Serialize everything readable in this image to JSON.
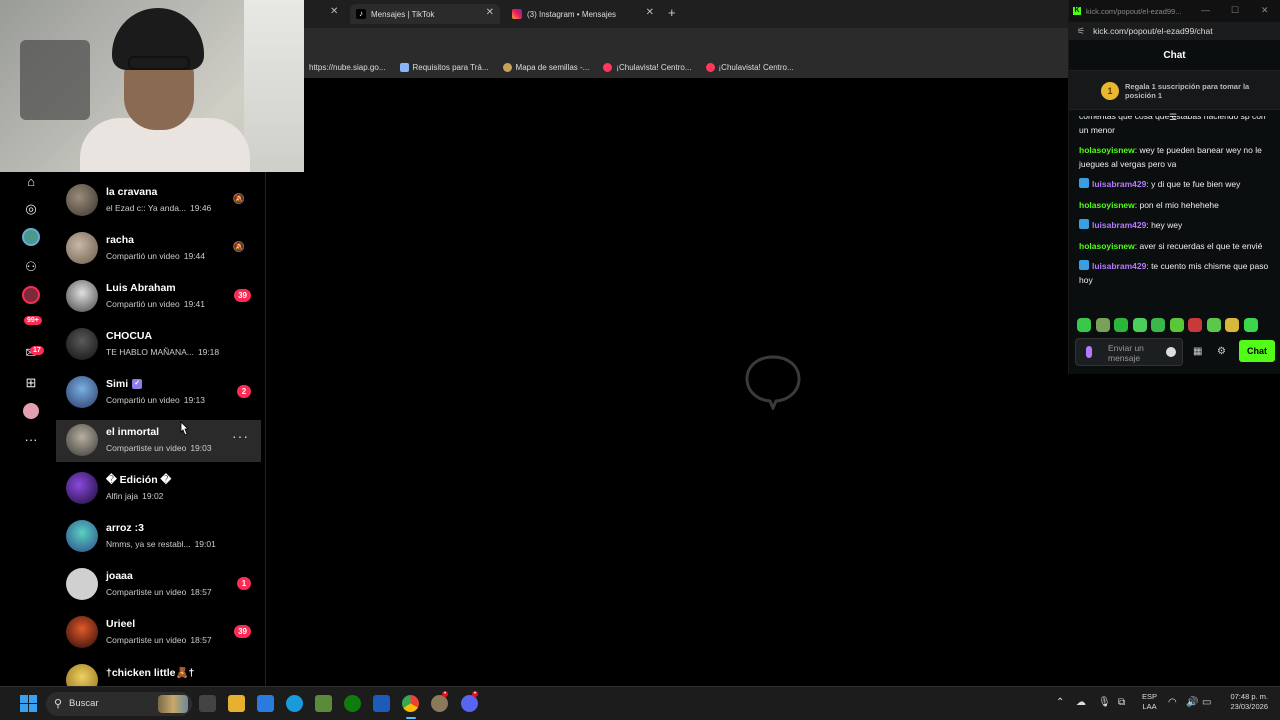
{
  "browser": {
    "tabs": [
      {
        "label": "Mensajes | TikTok",
        "icon": "tiktok-icon",
        "active": true
      },
      {
        "label": "(3) Instagram • Mensajes",
        "icon": "instagram-icon",
        "active": false
      }
    ],
    "bookmarks": [
      {
        "label": "https://nube.siap.go..."
      },
      {
        "label": "Requisitos para Trá..."
      },
      {
        "label": "Mapa de semillas -..."
      },
      {
        "label": "¡Chulavista! Centro..."
      },
      {
        "label": "¡Chulavista! Centro..."
      }
    ]
  },
  "left_nav": {
    "badges": {
      "activity": "99+",
      "inbox": "17"
    }
  },
  "conversations": [
    {
      "name": "la cravana",
      "preview": "el Ezad c:: Ya anda...",
      "time": "19:46",
      "muted": true
    },
    {
      "name": "racha",
      "preview": "Compartió un video",
      "time": "19:44",
      "muted": true
    },
    {
      "name": "Luis Abraham",
      "preview": "Compartió un video",
      "time": "19:41",
      "badge": "39"
    },
    {
      "name": "CHOCUA",
      "preview": "TE HABLO MAÑANA...",
      "time": "19:18"
    },
    {
      "name": "Simi",
      "preview": "Compartió un video",
      "time": "19:13",
      "badge": "2",
      "verified": true
    },
    {
      "name": "el inmortal",
      "preview": "Compartiste un video",
      "time": "19:03",
      "hover": true
    },
    {
      "name": "� Edición �",
      "preview": "Alfin jaja",
      "time": "19:02"
    },
    {
      "name": "arroz :3",
      "preview": "Nmms, ya se restabl...",
      "time": "19:01"
    },
    {
      "name": "joaaa",
      "preview": "Compartiste un video",
      "time": "18:57",
      "badge": "1"
    },
    {
      "name": "Urieel",
      "preview": "Compartiste un video",
      "time": "18:57",
      "badge": "39"
    },
    {
      "name": "†chicken little🧸†",
      "preview": "",
      "time": ""
    }
  ],
  "kick": {
    "window_url_short": "kick.com/popout/el-ezad99...",
    "url": "kick.com/popout/el-ezad99/chat",
    "header": "Chat",
    "gift_text": "Regala 1 suscripción para tomar la posición 1",
    "gift_rank": "1",
    "messages": [
      {
        "user": "",
        "text": "comentas que cosa que estabas haciendo sp con un menor",
        "color": ""
      },
      {
        "user": "holasoyisnew",
        "text": ": wey te pueden banear wey no le juegues al vergas pero va",
        "color": "green"
      },
      {
        "user": "luisabram429",
        "text": ": y di que te fue bien wey",
        "color": "purple",
        "sub": true
      },
      {
        "user": "holasoyisnew",
        "text": ": pon el mio hehehehe",
        "color": "green"
      },
      {
        "user": "luisabram429",
        "text": ": hey wey",
        "color": "purple",
        "sub": true
      },
      {
        "user": "holasoyisnew",
        "text": ": aver si recuerdas el que te envié",
        "color": "green"
      },
      {
        "user": "luisabram429",
        "text": ": te cuento mis chisme que paso hoy",
        "color": "purple",
        "sub": true
      }
    ],
    "input_placeholder": "Enviar un mensaje",
    "send_label": "Chat"
  },
  "taskbar": {
    "search_label": "Buscar",
    "lang_top": "ESP",
    "lang_bottom": "LAA",
    "time": "07:48 p. m.",
    "date": "23/03/2026"
  },
  "colors": {
    "tiktok_red": "#fe2c55",
    "kick_green": "#53fc18",
    "kick_purple": "#b57bff"
  }
}
